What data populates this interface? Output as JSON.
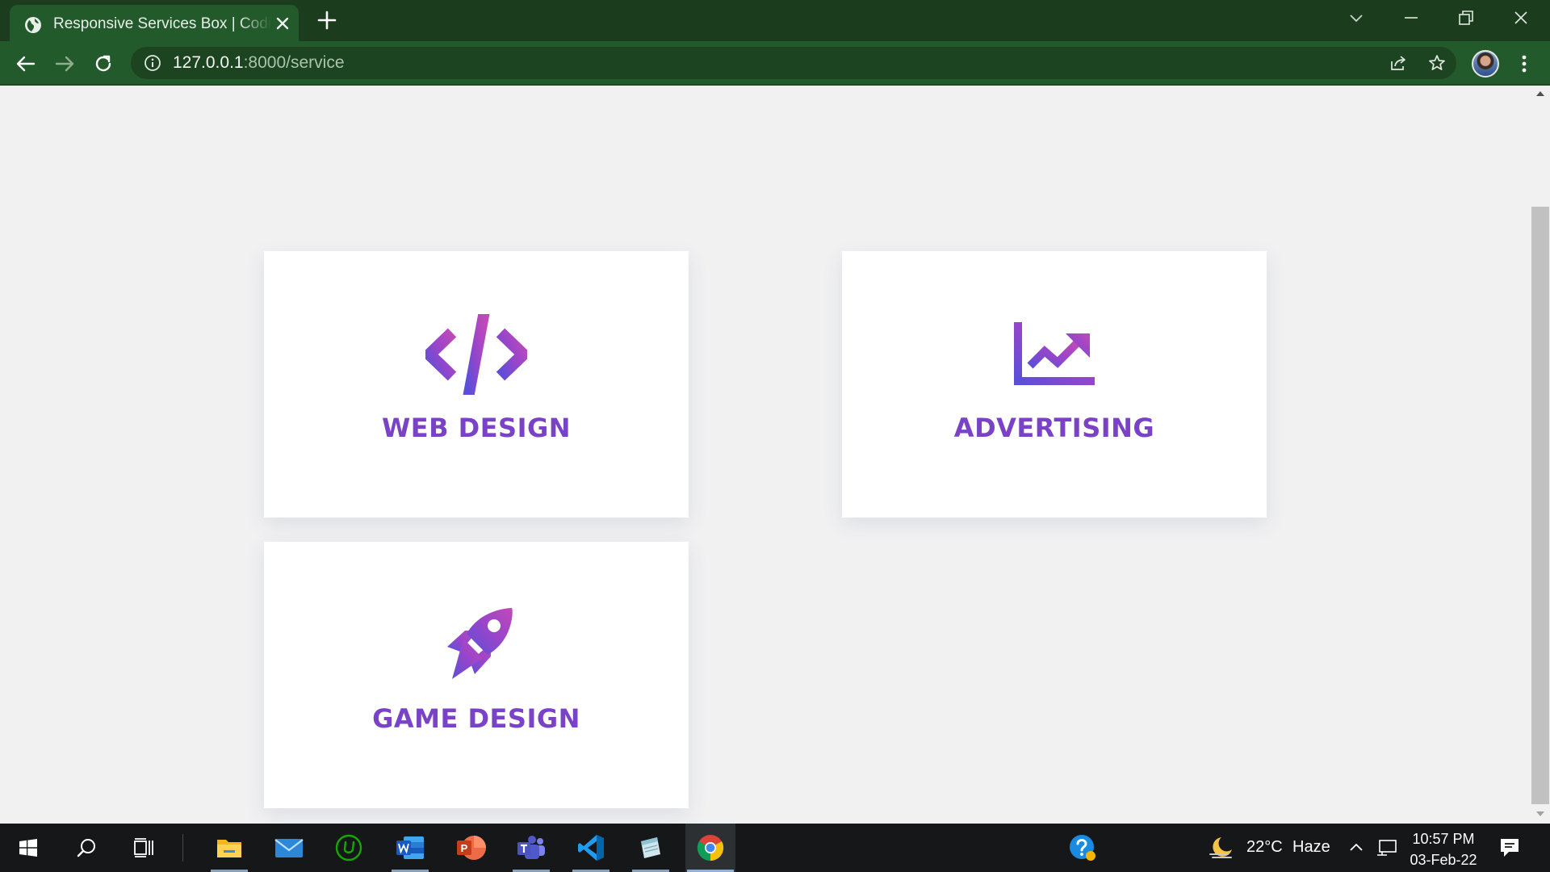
{
  "browser": {
    "tab_title": "Responsive Services Box | Coding",
    "url_host": "127.0.0.1",
    "url_path": ":8000/service",
    "theme_color": "#235a2b"
  },
  "services": [
    {
      "title": "WEB DESIGN",
      "icon": "code-icon"
    },
    {
      "title": "ADVERTISING",
      "icon": "chart-line-icon"
    },
    {
      "title": "GAME DESIGN",
      "icon": "rocket-icon"
    }
  ],
  "accent_gradient": [
    "#5b4fd9",
    "#9b45c9",
    "#c04ab8"
  ],
  "taskbar": {
    "apps": [
      "start-icon",
      "search-icon",
      "task-view-icon",
      "file-explorer-icon",
      "mail-icon",
      "upwork-icon",
      "word-icon",
      "powerpoint-icon",
      "teams-icon",
      "vscode-icon",
      "notes-icon",
      "chrome-icon"
    ],
    "temperature": "22°C",
    "weather": "Haze",
    "time": "10:57 PM",
    "date": "03-Feb-22"
  }
}
